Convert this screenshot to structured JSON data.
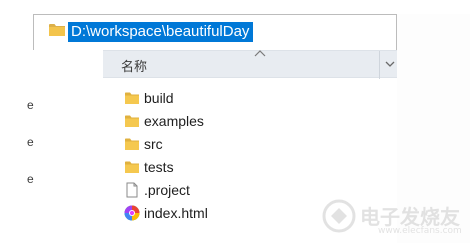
{
  "address_bar": {
    "path": "D:\\workspace\\beautifulDay",
    "icon": "folder-icon"
  },
  "columns": {
    "name_label": "名称"
  },
  "nav_fragments": [
    "e",
    "e",
    "e"
  ],
  "files": [
    {
      "name": "build",
      "icon": "folder-icon",
      "type": "folder"
    },
    {
      "name": "examples",
      "icon": "folder-icon",
      "type": "folder"
    },
    {
      "name": "src",
      "icon": "folder-icon",
      "type": "folder"
    },
    {
      "name": "tests",
      "icon": "folder-icon",
      "type": "folder"
    },
    {
      "name": ".project",
      "icon": "file-icon",
      "type": "file"
    },
    {
      "name": "index.html",
      "icon": "browser-html-icon",
      "type": "html"
    }
  ],
  "colors": {
    "selection": "#0078d7",
    "folder": "#f3c44c",
    "header_bg": "#e8ecf1"
  },
  "watermark": {
    "text": "电子发烧友",
    "url": "www.elecfans.com"
  }
}
